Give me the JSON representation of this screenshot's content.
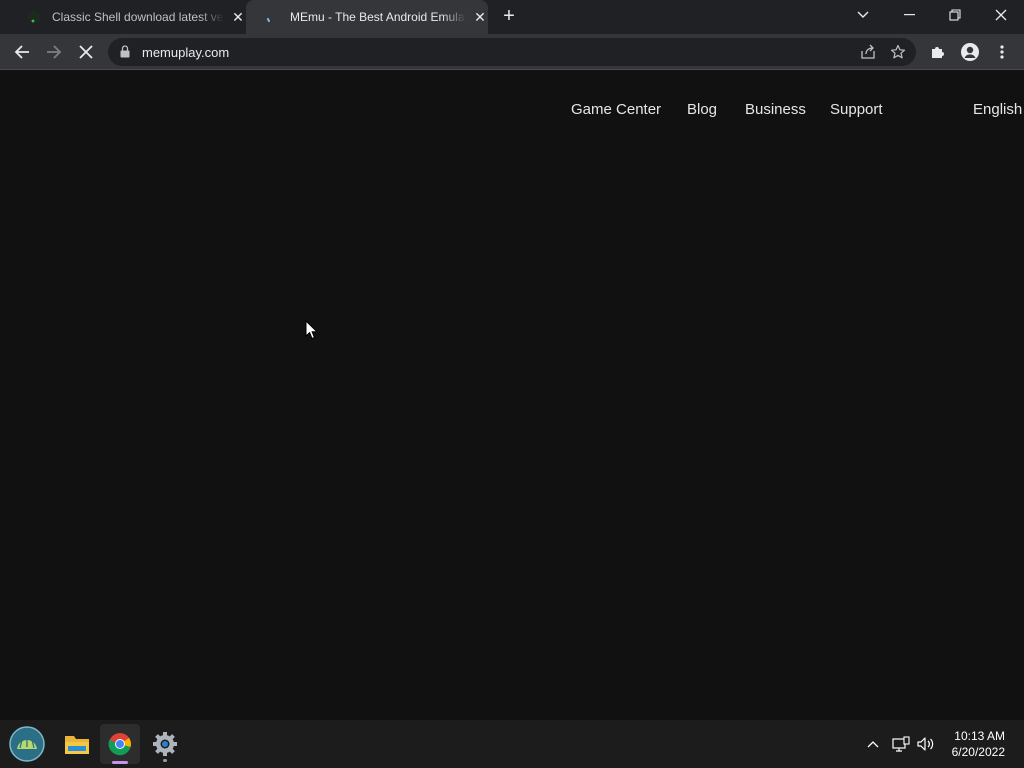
{
  "browser": {
    "tabs": [
      {
        "title": "Classic Shell download latest version",
        "active": false
      },
      {
        "title": "MEmu - The Best Android Emulator",
        "active": true
      }
    ],
    "address": {
      "url": "memuplay.com"
    }
  },
  "page": {
    "nav": {
      "links": [
        "Game Center",
        "Blog",
        "Business",
        "Support"
      ],
      "language": "English"
    }
  },
  "taskbar": {
    "apps": [
      "start-button",
      "file-explorer",
      "chrome",
      "settings"
    ],
    "clock": {
      "time": "10:13 AM",
      "date": "6/20/2022"
    }
  },
  "colors": {
    "page_background": "#111111",
    "chrome_dark": "#202124",
    "chrome_toolbar": "#35363a",
    "taskbar": "#1c1c1c",
    "active_indicator": "#c792ea"
  }
}
